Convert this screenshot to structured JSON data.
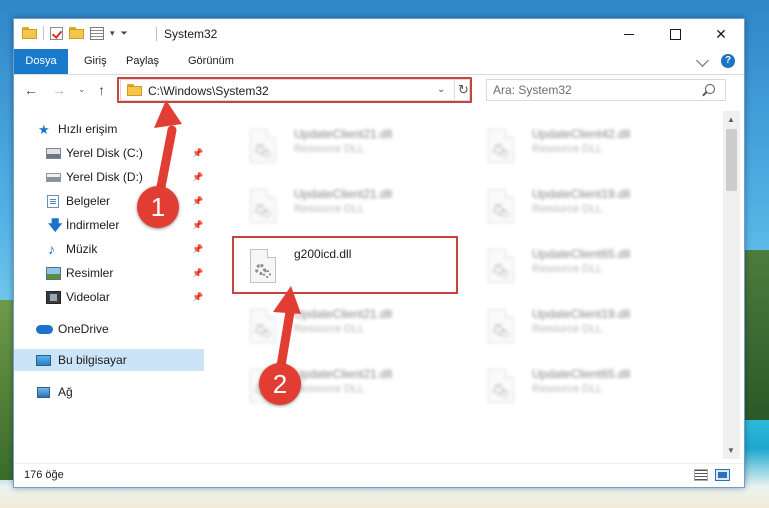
{
  "window": {
    "title": "System32"
  },
  "ribbon": {
    "tabs": [
      "Dosya",
      "Giriş",
      "Paylaş",
      "Görünüm"
    ],
    "help": "?"
  },
  "nav": {
    "address": "C:\\Windows\\System32",
    "search_placeholder": "Ara: System32"
  },
  "sidebar": {
    "items": [
      {
        "label": "Hızlı erişim"
      },
      {
        "label": "Yerel Disk (C:)"
      },
      {
        "label": "Yerel Disk (D:)"
      },
      {
        "label": "Belgeler"
      },
      {
        "label": "İndirmeler"
      },
      {
        "label": "Müzik"
      },
      {
        "label": "Resimler"
      },
      {
        "label": "Videolar"
      },
      {
        "label": "OneDrive"
      },
      {
        "label": "Bu bilgisayar"
      },
      {
        "label": "Ağ"
      }
    ]
  },
  "files": [
    {
      "name": "UpdateClient21.dll",
      "type": "Resource DLL"
    },
    {
      "name": "UpdateClient42.dll",
      "type": "Resource DLL"
    },
    {
      "name": "UpdateClient21.dll",
      "type": "Resource DLL"
    },
    {
      "name": "UpdateClient19.dll",
      "type": "Resource DLL"
    },
    {
      "name": "g200icd.dll",
      "type": ""
    },
    {
      "name": "UpdateClient65.dll",
      "type": "Resource DLL"
    },
    {
      "name": "UpdateClient21.dll",
      "type": "Resource DLL"
    },
    {
      "name": "UpdateClient19.dll",
      "type": "Resource DLL"
    },
    {
      "name": "UpdateClient21.dll",
      "type": "Resource DLL"
    },
    {
      "name": "UpdateClient65.dll",
      "type": "Resource DLL"
    }
  ],
  "status": {
    "item_count": "176 öğe"
  },
  "callouts": {
    "one": "1",
    "two": "2"
  },
  "colors": {
    "accent": "#1979ca",
    "highlight": "#c9423e",
    "callout": "#e23d33",
    "selected": "#cce4f7"
  }
}
